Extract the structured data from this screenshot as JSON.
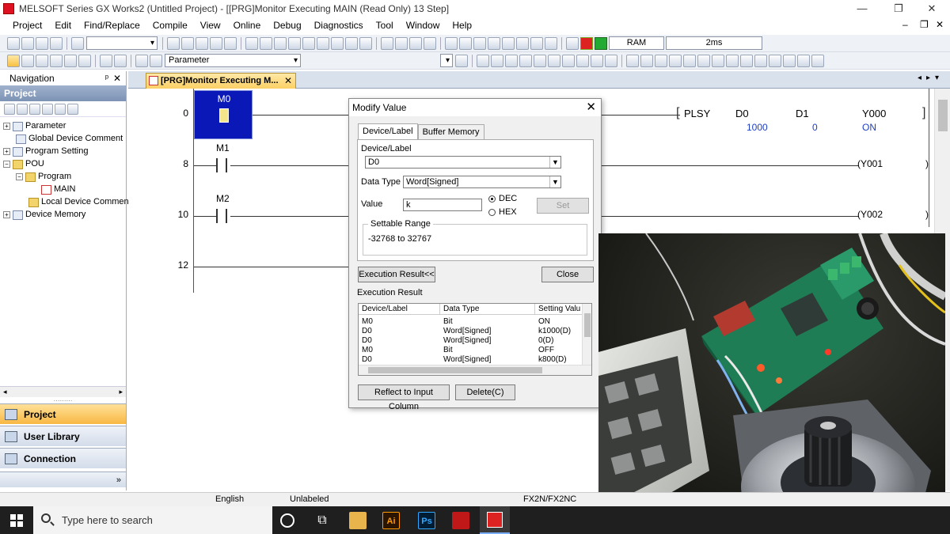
{
  "window": {
    "title": "MELSOFT Series GX Works2 (Untitled Project) - [[PRG]Monitor Executing MAIN (Read Only) 13 Step]",
    "minimize": "—",
    "restore": "❐",
    "close": "✕"
  },
  "menu": {
    "items": [
      "Project",
      "Edit",
      "Find/Replace",
      "Compile",
      "View",
      "Online",
      "Debug",
      "Diagnostics",
      "Tool",
      "Window",
      "Help"
    ],
    "mdi_min": "‒",
    "mdi_restore": "❐",
    "mdi_close": "✕"
  },
  "toolbar": {
    "memory": "RAM",
    "scan_time": "2ms",
    "parameter_combo": "Parameter"
  },
  "navigation": {
    "title": "Navigation",
    "pin": "ᵖ",
    "close": "✕",
    "section": "Project",
    "tree": [
      {
        "label": "Parameter",
        "exp": "+",
        "indent": 0
      },
      {
        "label": "Global Device Comment",
        "exp": "",
        "indent": 1
      },
      {
        "label": "Program Setting",
        "exp": "+",
        "indent": 0
      },
      {
        "label": "POU",
        "exp": "−",
        "indent": 0
      },
      {
        "label": "Program",
        "exp": "−",
        "indent": 1
      },
      {
        "label": "MAIN",
        "exp": "",
        "indent": 2
      },
      {
        "label": "Local Device Comment",
        "exp": "",
        "indent": 1
      },
      {
        "label": "Device Memory",
        "exp": "+",
        "indent": 0
      }
    ],
    "buttons": [
      "Project",
      "User Library",
      "Connection Destination"
    ],
    "more": "»"
  },
  "doc_tab": {
    "label": "[PRG]Monitor Executing M...",
    "close": "✕"
  },
  "ladder": {
    "steps": [
      "0",
      "8",
      "10",
      "12"
    ],
    "rung0": {
      "contact": "M0",
      "instruction": "PLSY",
      "op1": "D0",
      "op2": "D1",
      "op3": "Y000",
      "op1_val": "1000",
      "op2_val": "0",
      "op3_val": "ON"
    },
    "rung1": {
      "contact": "M1",
      "coil": "Y001"
    },
    "rung2": {
      "contact": "M2",
      "coil": "Y002"
    }
  },
  "dialog": {
    "title": "Modify Value",
    "close": "✕",
    "tabs": [
      "Device/Label",
      "Buffer Memory"
    ],
    "device_label_caption": "Device/Label",
    "device_value": "D0",
    "data_type_caption": "Data Type",
    "data_type_value": "Word[Signed]",
    "value_caption": "Value",
    "value_input": "k",
    "radio_dec": "DEC",
    "radio_hex": "HEX",
    "set_button": "Set",
    "settable_range_caption": "Settable Range",
    "settable_range": "-32768 to 32767",
    "exec_result_button": "Execution Result<<",
    "close_button": "Close",
    "exec_result_caption": "Execution Result",
    "columns": [
      "Device/Label",
      "Data Type",
      "Setting Valu"
    ],
    "rows": [
      [
        "M0",
        "Bit",
        "ON"
      ],
      [
        "D0",
        "Word[Signed]",
        "k1000(D)"
      ],
      [
        "D0",
        "Word[Signed]",
        "0(D)"
      ],
      [
        "M0",
        "Bit",
        "OFF"
      ],
      [
        "D0",
        "Word[Signed]",
        "k800(D)"
      ]
    ],
    "reflect_button": "Reflect to Input Column",
    "delete_button": "Delete(C)"
  },
  "statusbar": {
    "language": "English",
    "label": "Unlabeled",
    "plc": "FX2N/FX2NC"
  },
  "taskbar": {
    "search_placeholder": "Type here to search",
    "apps": [
      "Ai",
      "Ps"
    ]
  },
  "colors": {
    "selection_blue": "#0a18b8",
    "tab_gold": "#fbd064",
    "monitor_blue": "#1d3ec2"
  }
}
